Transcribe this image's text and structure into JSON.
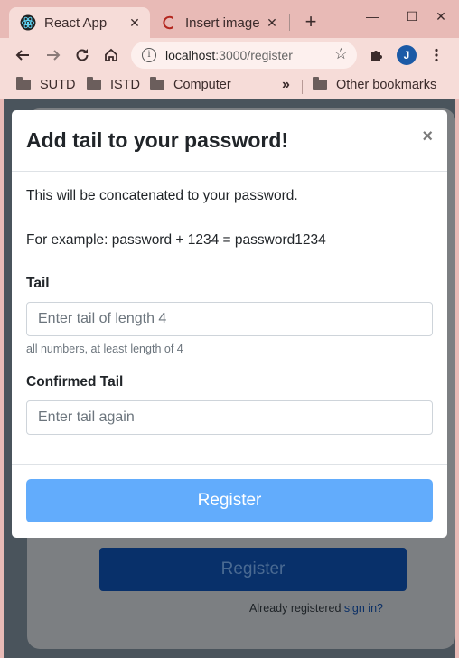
{
  "browser": {
    "active_tab": "React App",
    "inactive_tab": "Insert image",
    "url_host": "localhost",
    "url_path": ":3000/register",
    "profile_initial": "J",
    "bookmarks": [
      "SUTD",
      "ISTD",
      "Computer"
    ],
    "bookmarks_overflow": "»",
    "other_bookmarks": "Other bookmarks"
  },
  "background_page": {
    "register_label": "Register",
    "already_text": "Already registered ",
    "sign_in_link": "sign in?"
  },
  "modal": {
    "title": "Add tail to your password!",
    "close": "×",
    "intro": "This will be concatenated to your password.",
    "example": "For example: password + 1234 = password1234",
    "tail_label": "Tail",
    "tail_placeholder": "Enter tail of length 4",
    "tail_help": "all numbers, at least length of 4",
    "confirm_label": "Confirmed Tail",
    "confirm_placeholder": "Enter tail again",
    "register_label": "Register"
  },
  "colors": {
    "chrome": "#e8bab6",
    "toolbar": "#f6dcd8",
    "primary_button": "#62acfc",
    "bg_button": "#08306a",
    "link": "#0a2f66"
  }
}
